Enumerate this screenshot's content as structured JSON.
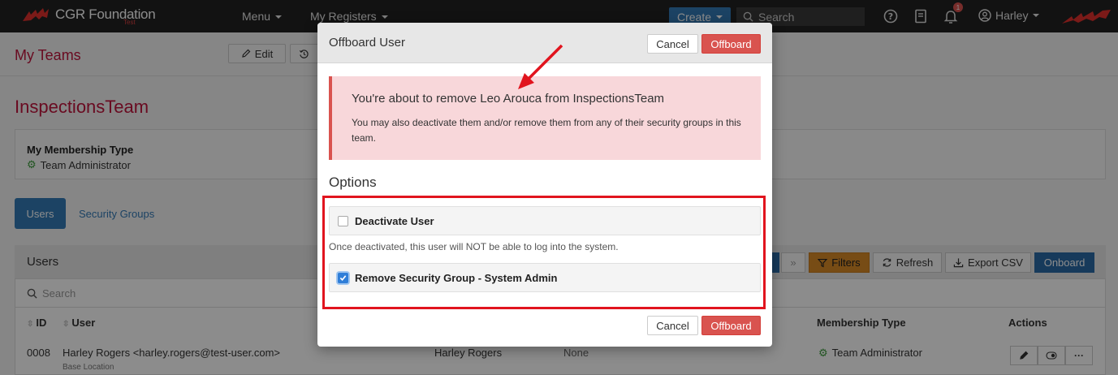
{
  "navbar": {
    "brand": "CGR Foundation",
    "brand_sub": "Test",
    "menu": "Menu",
    "registers": "My Registers",
    "create": "Create",
    "search_placeholder": "Search",
    "notification_count": "1",
    "user": "Harley"
  },
  "page": {
    "title": "My Teams",
    "edit_label": "Edit",
    "team_name": "InspectionsTeam",
    "membership_label": "My Membership Type",
    "membership_value": "Team Administrator",
    "tabs": {
      "users": "Users",
      "security_groups": "Security Groups"
    }
  },
  "users_panel": {
    "title": "Users",
    "search_placeholder": "Search",
    "toolbar": {
      "filters": "Filters",
      "refresh": "Refresh",
      "export": "Export CSV",
      "onboard": "Onboard"
    },
    "columns": {
      "id": "ID",
      "user": "User",
      "membership": "Membership Type",
      "actions": "Actions"
    },
    "rows": [
      {
        "id": "0008",
        "user": "Harley Rogers <harley.rogers@test-user.com>",
        "location": "Base Location",
        "name": "Harley Rogers",
        "group": "None",
        "membership": "Team Administrator"
      }
    ]
  },
  "modal": {
    "title": "Offboard User",
    "cancel_label": "Cancel",
    "offboard_label": "Offboard",
    "alert_title": "You're about to remove Leo Arouca from InspectionsTeam",
    "alert_text": "You may also deactivate them and/or remove them from any of their security groups in this team.",
    "options_title": "Options",
    "options": [
      {
        "label": "Deactivate User",
        "checked": false
      },
      {
        "label": "Remove Security Group - System Admin",
        "checked": true
      }
    ],
    "deactivate_help": "Once deactivated, this user will NOT be able to log into the system."
  },
  "colors": {
    "accent_red": "#d9534f",
    "primary_blue": "#337ab7",
    "title_red": "#c0143c",
    "highlight": "#e1141e"
  }
}
